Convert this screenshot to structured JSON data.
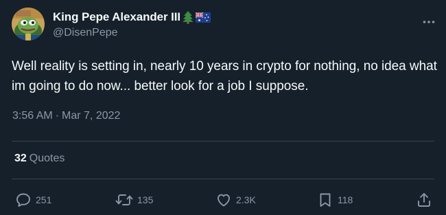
{
  "tweet": {
    "author": {
      "display_name": "King Pepe Alexander III",
      "flair": [
        "evergreen-tree-emoji",
        "australia-flag-emoji"
      ],
      "handle": "@DisenPepe"
    },
    "text": "Well reality is setting in, nearly 10 years in crypto for nothing, no idea what im going to do now... better look for a job I suppose.",
    "time": "3:56 AM",
    "separator": "·",
    "date": "Mar 7, 2022",
    "quotes": {
      "count": "32",
      "label": "Quotes"
    },
    "actions": {
      "reply": {
        "icon": "reply-icon",
        "count": "251"
      },
      "retweet": {
        "icon": "retweet-icon",
        "count": "135"
      },
      "like": {
        "icon": "heart-icon",
        "count": "2.3K"
      },
      "bookmark": {
        "icon": "bookmark-icon",
        "count": "118"
      },
      "share": {
        "icon": "share-icon"
      }
    }
  },
  "colors": {
    "background": "#15202b",
    "primary_text": "#f7f9f9",
    "secondary_text": "#8b98a5",
    "divider": "#38444d"
  }
}
